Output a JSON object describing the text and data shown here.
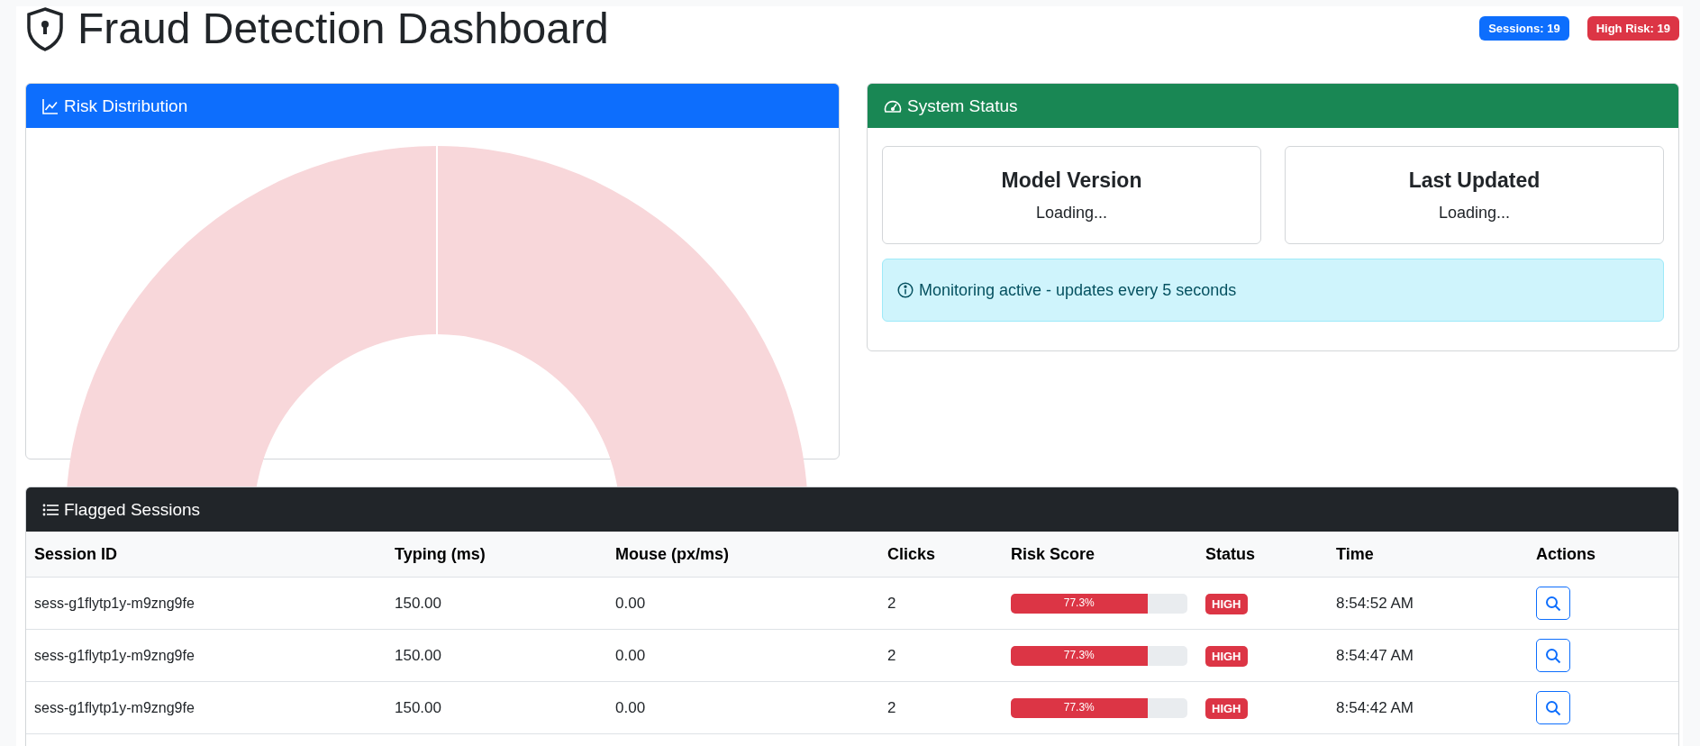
{
  "header": {
    "title": "Fraud Detection Dashboard",
    "badges": [
      {
        "text": "Sessions: 19",
        "color": "#0d6efd"
      },
      {
        "text": "High Risk: 19",
        "color": "#dc3545"
      }
    ]
  },
  "risk_distribution": {
    "title": "Risk Distribution"
  },
  "system_status": {
    "title": "System Status",
    "stats": [
      {
        "label": "Model Version",
        "value": "Loading..."
      },
      {
        "label": "Last Updated",
        "value": "Loading..."
      }
    ],
    "alert": "Monitoring active - updates every 5 seconds"
  },
  "flagged_sessions": {
    "title": "Flagged Sessions",
    "columns": [
      "Session ID",
      "Typing (ms)",
      "Mouse (px/ms)",
      "Clicks",
      "Risk Score",
      "Status",
      "Time",
      "Actions"
    ],
    "rows": [
      {
        "session_id": "sess-g1flytp1y-m9zng9fe",
        "typing": "150.00",
        "mouse": "0.00",
        "clicks": "2",
        "risk": {
          "level": 0.773,
          "reading": "77.3%"
        },
        "status": {
          "text": "HIGH",
          "color": "#dc3545"
        },
        "time": "8:54:52 AM"
      },
      {
        "session_id": "sess-g1flytp1y-m9zng9fe",
        "typing": "150.00",
        "mouse": "0.00",
        "clicks": "2",
        "risk": {
          "level": 0.773,
          "reading": "77.3%"
        },
        "status": {
          "text": "HIGH",
          "color": "#dc3545"
        },
        "time": "8:54:47 AM"
      },
      {
        "session_id": "sess-g1flytp1y-m9zng9fe",
        "typing": "150.00",
        "mouse": "0.00",
        "clicks": "2",
        "risk": {
          "level": 0.773,
          "reading": "77.3%"
        },
        "status": {
          "text": "HIGH",
          "color": "#dc3545"
        },
        "time": "8:54:42 AM"
      }
    ]
  }
}
